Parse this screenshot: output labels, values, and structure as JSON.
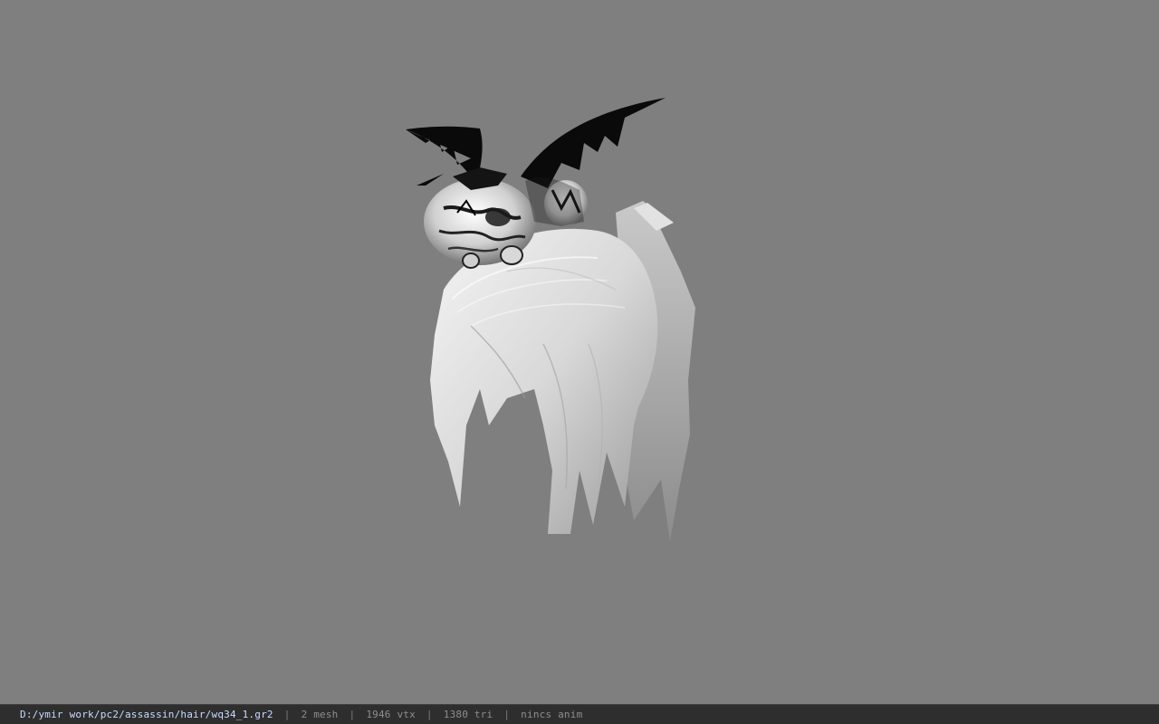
{
  "viewer": {
    "background_color": "#7f7f7f",
    "model": {
      "description_icon": "hair-model-with-bat-cat-ornament"
    }
  },
  "status_bar": {
    "file_path": "D:/ymir work/pc2/assassin/hair/wq34_1.gr2",
    "separator": "|",
    "mesh_count": "2 mesh",
    "vertex_count": "1946 vtx",
    "triangle_count": "1380 tri",
    "animation": "nincs anim",
    "path_color": "#c8dcff",
    "text_color": "#8e8e8e"
  }
}
